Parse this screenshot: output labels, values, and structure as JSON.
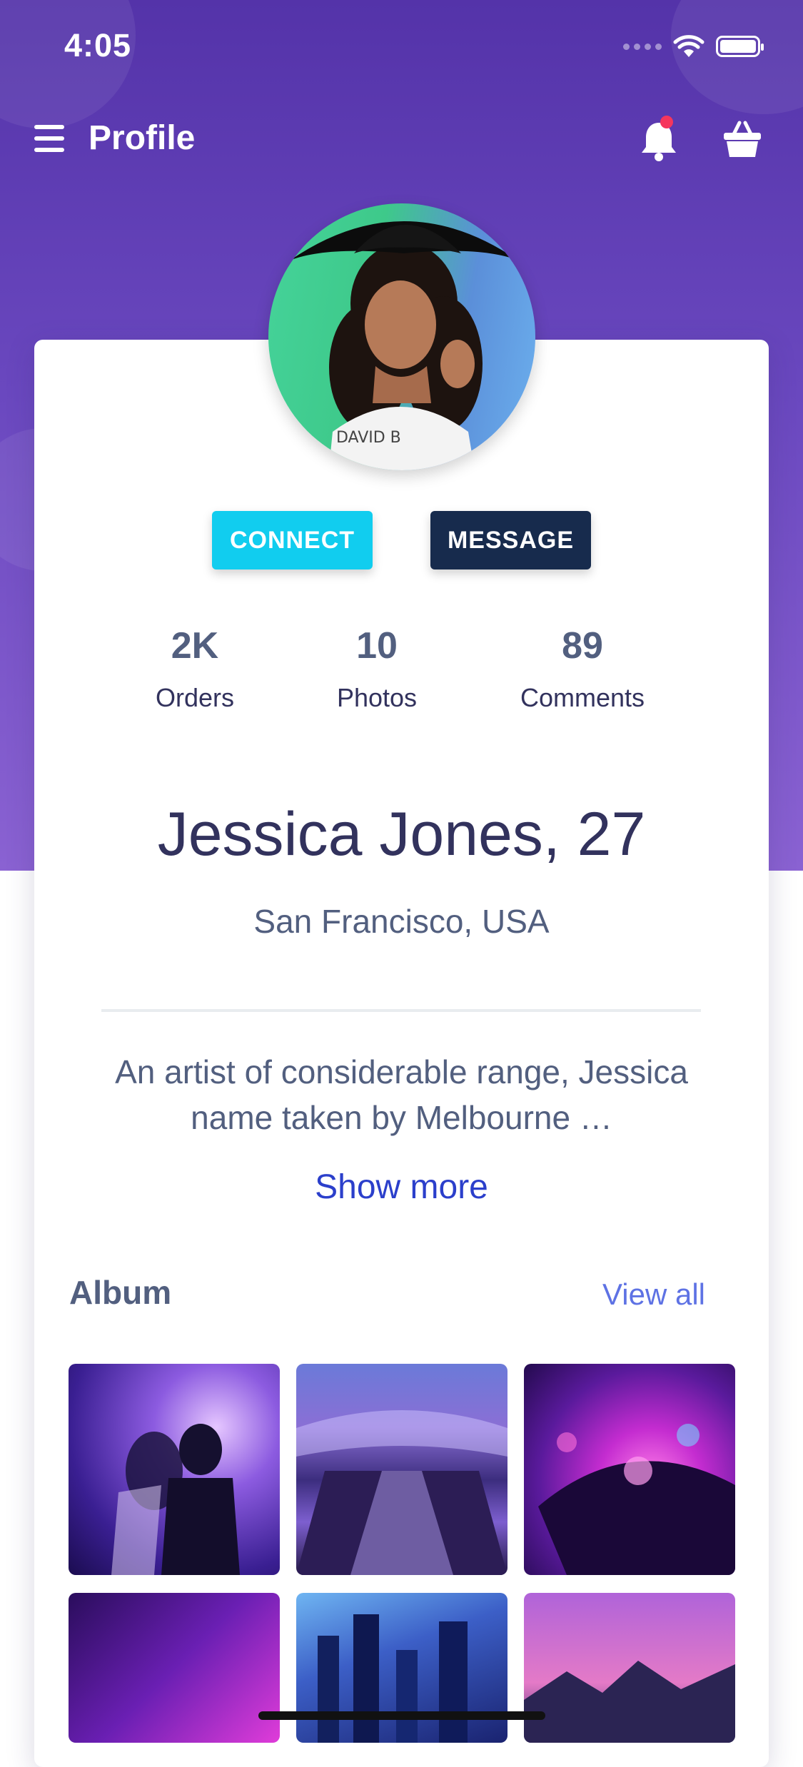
{
  "status_bar": {
    "time": "4:05"
  },
  "navbar": {
    "title": "Profile",
    "notification_dot_color": "#f5365c"
  },
  "profile": {
    "connect_label": "CONNECT",
    "message_label": "MESSAGE",
    "stats": [
      {
        "value": "2K",
        "label": "Orders"
      },
      {
        "value": "10",
        "label": "Photos"
      },
      {
        "value": "89",
        "label": "Comments"
      }
    ],
    "name": "Jessica Jones, 27",
    "location": "San Francisco, USA",
    "bio": "An artist of considerable range, Jessica name taken by Melbourne …",
    "show_more": "Show more"
  },
  "album": {
    "title": "Album",
    "view_all": "View all"
  },
  "colors": {
    "primary_purple": "#6a48bf",
    "connect": "#11cdef",
    "message": "#172b4d",
    "link": "#2b3fcb"
  }
}
